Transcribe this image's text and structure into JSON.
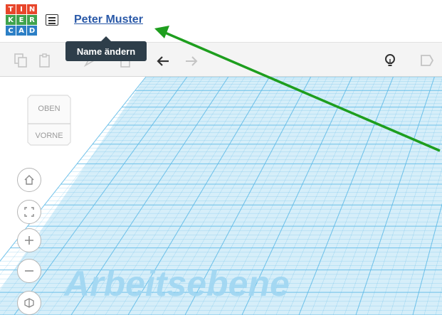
{
  "app": {
    "logo_letters": [
      "T",
      "I",
      "N",
      "K",
      "E",
      "R",
      "C",
      "A",
      "D"
    ],
    "logo_colors": [
      "#e8462b",
      "#e8462b",
      "#e8462b",
      "#3fa34d",
      "#3fa34d",
      "#3fa34d",
      "#2c7fc6",
      "#2c7fc6",
      "#2c7fc6"
    ]
  },
  "header": {
    "design_name": "Peter Muster",
    "tooltip": "Name ändern"
  },
  "viewcube": {
    "top": "OBEN",
    "front": "VORNE"
  },
  "workplane": {
    "label": "Arbeitsebene",
    "grid_color": "#5bb8e6"
  },
  "annotation": {
    "arrow_color": "#1e9e1e"
  },
  "icons": {
    "toolbar": [
      "copy-icon",
      "paste-icon",
      "duplicate-icon",
      "delete-icon",
      "undo-icon",
      "redo-icon",
      "lightbulb-icon",
      "note-icon"
    ],
    "nav": [
      "home-icon",
      "fit-icon",
      "zoom-in-icon",
      "zoom-out-icon",
      "perspective-icon"
    ]
  }
}
